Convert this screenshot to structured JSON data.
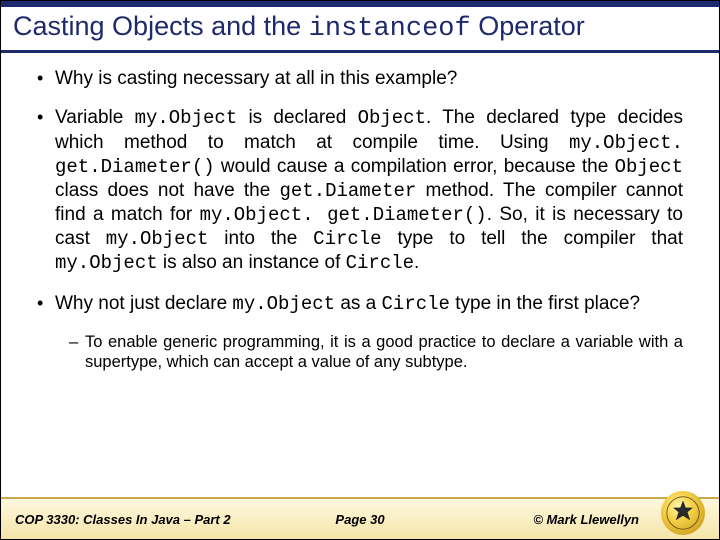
{
  "title_pre": "Casting Objects and the ",
  "title_code": "instanceof",
  "title_post": " Operator",
  "bullets": {
    "b1": "Why is casting necessary at all in this example?",
    "b2": {
      "s1": "Variable ",
      "c1": "my.Object",
      "s2": " is declared ",
      "c2": "Object",
      "s3": ".  The declared type decides which method to match at compile time.  Using ",
      "c3": "my.Object. get.Diameter()",
      "s4": " would cause a compilation error, because the ",
      "c4": "Object",
      "s5": " class does not have the ",
      "c5": "get.Diameter",
      "s6": " method.  The compiler cannot find a match for ",
      "c6": "my.Object. get.Diameter()",
      "s7": ".  So, it is necessary to cast ",
      "c7": "my.Object",
      "s8": " into the ",
      "c8": "Circle",
      "s9": " type to tell the compiler that ",
      "c9": "my.Object",
      "s10": " is also an instance of ",
      "c10": "Circle",
      "s11": "."
    },
    "b3": {
      "s1": "Why not just declare ",
      "c1": "my.Object",
      "s2": " as a ",
      "c2": "Circle",
      "s3": " type in the first place?"
    },
    "sub1": "To enable generic programming, it is a good practice to declare a variable with a supertype, which can accept a value of any subtype."
  },
  "footer": {
    "course": "COP 3330:  Classes In Java – Part 2",
    "page": "Page 30",
    "copy": "© Mark Llewellyn"
  }
}
